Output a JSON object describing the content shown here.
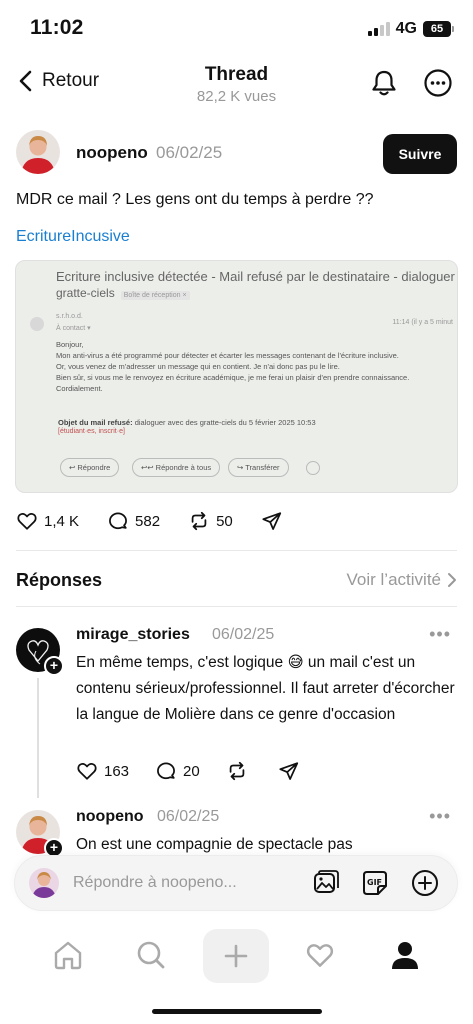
{
  "status": {
    "time": "11:02",
    "network": "4G",
    "battery": "65"
  },
  "header": {
    "back_label": "Retour",
    "title": "Thread",
    "views": "82,2 K vues"
  },
  "post": {
    "username": "noopeno",
    "date": "06/02/25",
    "follow_label": "Suivre",
    "text": "MDR ce mail ? Les gens ont du temps à perdre ??",
    "hashtag": "EcritureIncusive",
    "image": {
      "subject": "Ecriture inclusive détectée - Mail refusé par le destinataire - dialoguer",
      "subject_line2": "gratte-ciels",
      "inbox_tag": "Boîte de réception ×",
      "from": "s.r.h.o.d.",
      "to": "À contact ▾",
      "time": "11:14 (il y a 5 minut",
      "body": [
        "Bonjour,",
        "Mon anti-virus a été programmé pour détecter et écarter les messages contenant de l'écriture inclusive.",
        "Or, vous venez de m'adresser un message qui en contient. Je n'ai donc pas pu le lire.",
        "Bien sûr, si vous me le renvoyez en écriture académique, je me ferai un plaisir d'en prendre connaissance.",
        "Cordialement."
      ],
      "objet_label": "Objet du mail refusé:",
      "objet_value": " dialoguer avec des gratte-ciels du 5 février 2025 10:53",
      "objet_red": "[étudiant·es, inscrit·e]",
      "buttons": [
        "Répondre",
        "Répondre à tous",
        "Transférer"
      ]
    },
    "likes": "1,4 K",
    "comments": "582",
    "reposts": "50"
  },
  "replies": {
    "title": "Réponses",
    "activity_label": "Voir l’activité",
    "items": [
      {
        "username": "mirage_stories",
        "date": "06/02/25",
        "text": "En même temps, c'est logique 😅 un mail c'est un contenu sérieux/professionnel. Il faut arreter d'écorcher la langue de Molière dans ce genre d'occasion",
        "likes": "163",
        "comments": "20"
      },
      {
        "username": "noopeno",
        "date": "06/02/25",
        "text": "On est une compagnie de spectacle pas"
      }
    ]
  },
  "composer": {
    "placeholder": "Répondre à noopeno..."
  },
  "colors": {
    "link": "#1a7fd1",
    "muted": "#999999",
    "text": "#111111"
  }
}
